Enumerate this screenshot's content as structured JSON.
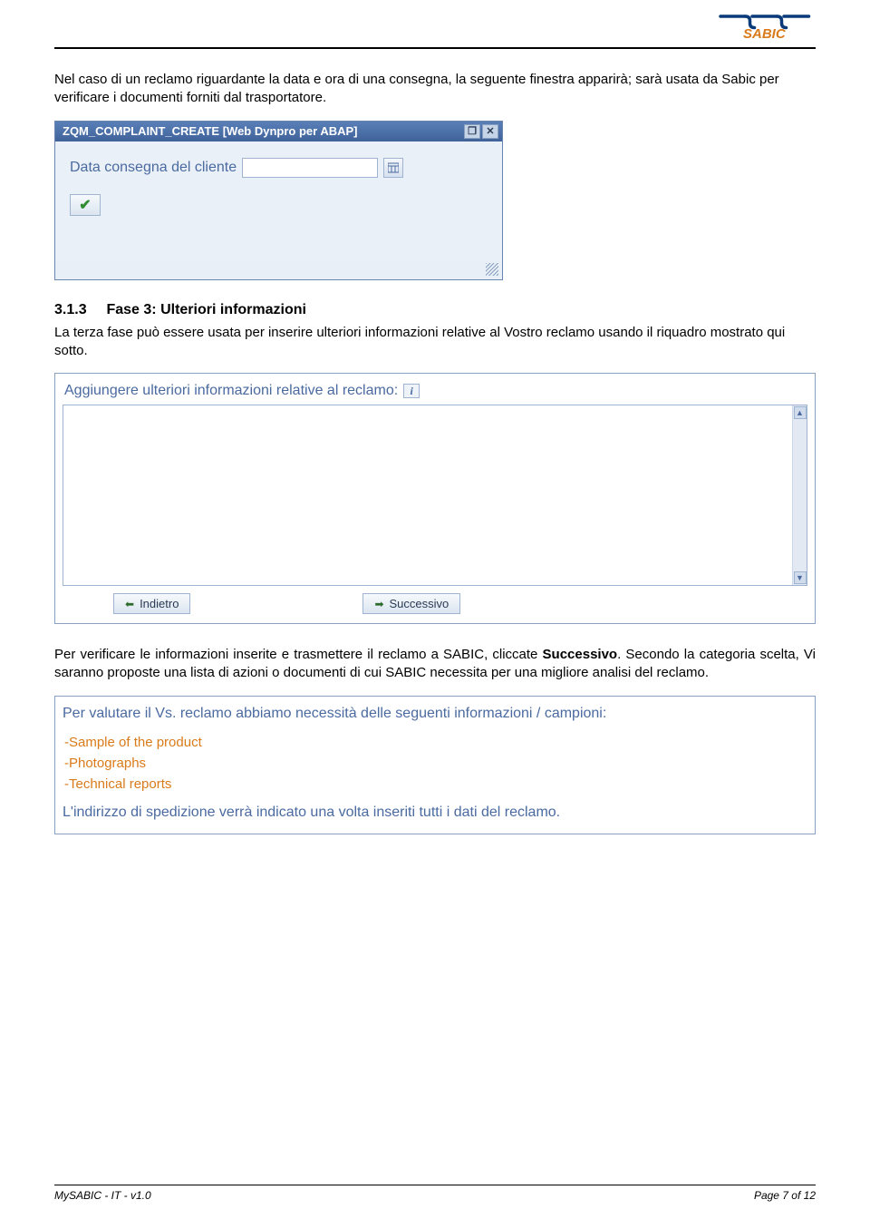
{
  "intro_para": "Nel caso di un reclamo riguardante la data e ora di una consegna, la seguente finestra apparirà; sarà usata da Sabic per verificare i documenti forniti dal trasportatore.",
  "popup": {
    "title": "ZQM_COMPLAINT_CREATE [Web Dynpro per ABAP]",
    "field_label": "Data consegna del cliente"
  },
  "section": {
    "num": "3.1.3",
    "title": "Fase 3: Ulteriori informazioni",
    "body": "La terza fase può essere usata per inserire ulteriori informazioni relative al Vostro reclamo usando il riquadro mostrato qui sotto."
  },
  "panel": {
    "label": "Aggiungere ulteriori informazioni relative al reclamo:",
    "back_label": "Indietro",
    "next_label": "Successivo"
  },
  "verify_text_pre": "Per verificare le informazioni inserite e trasmettere il reclamo a SABIC, cliccate ",
  "verify_text_bold": "Successivo",
  "verify_text_post": ". Secondo la categoria scelta, Vi saranno proposte una lista di azioni o documenti di cui SABIC necessita per una migliore analisi del reclamo.",
  "notice": {
    "heading": "Per valutare il Vs. reclamo abbiamo necessità delle seguenti informazioni / campioni:",
    "items": [
      "-Sample of the product",
      "-Photographs",
      "-Technical reports"
    ],
    "footer": "L'indirizzo di spedizione verrà indicato una volta inseriti tutti i dati del reclamo."
  },
  "footer": {
    "left": "MySABIC - IT - v1.0",
    "right": "Page 7 of 12"
  }
}
